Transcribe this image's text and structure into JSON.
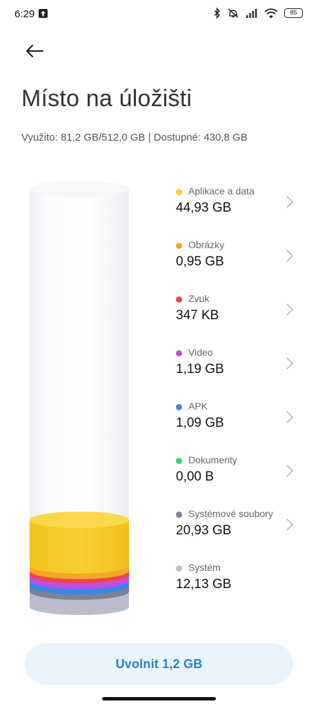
{
  "status_bar": {
    "time": "6:29",
    "battery": "85",
    "icons": [
      "upload-icon",
      "bluetooth-icon",
      "mute-icon",
      "signal-icon",
      "wifi-icon",
      "battery-icon"
    ]
  },
  "header": {
    "back_icon": "arrow-left-icon",
    "title": "Místo na úložišti"
  },
  "summary": {
    "text": "Využito: 81,2 GB/512,0 GB | Dostupné: 430,8 GB"
  },
  "categories": [
    {
      "label": "Aplikace a data",
      "value": "44,93 GB",
      "color": "#f5cc2a",
      "has_chevron": true
    },
    {
      "label": "Obrázky",
      "value": "0,95 GB",
      "color": "#f5a623",
      "has_chevron": true
    },
    {
      "label": "Zvuk",
      "value": "347 KB",
      "color": "#e8474c",
      "has_chevron": true
    },
    {
      "label": "Video",
      "value": "1,19 GB",
      "color": "#c14ee0",
      "has_chevron": true
    },
    {
      "label": "APK",
      "value": "1,09 GB",
      "color": "#3d84e6",
      "has_chevron": true
    },
    {
      "label": "Dokumenty",
      "value": "0,00 B",
      "color": "#2fd17e",
      "has_chevron": true
    },
    {
      "label": "Systémové soubory",
      "value": "20,93 GB",
      "color": "#7a8295",
      "has_chevron": true
    },
    {
      "label": "Systém",
      "value": "12,13 GB",
      "color": "#b9bdcc",
      "has_chevron": false
    }
  ],
  "actions": {
    "free_label": "Uvolnit 1,2 GB"
  }
}
